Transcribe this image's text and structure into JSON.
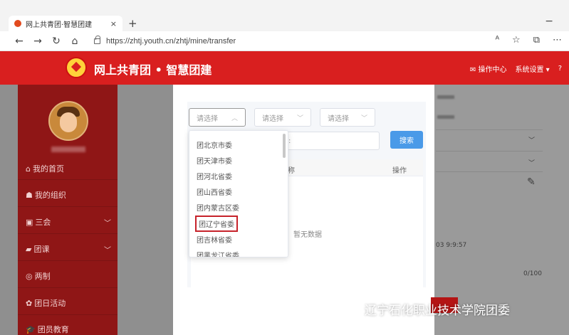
{
  "browser": {
    "tab_title": "网上共青团·智慧团建",
    "tab_close": "×",
    "new_tab": "+",
    "minimize": "−",
    "url": "https://zhtj.youth.cn/zhtj/mine/transfer",
    "nav_icons": [
      "back-arrow-icon",
      "forward-arrow-icon",
      "refresh-icon",
      "home-icon"
    ],
    "addr_icons": [
      "read-aloud-icon",
      "favorite-star-icon",
      "collections-icon",
      "more-icon"
    ]
  },
  "header": {
    "site_title": "网上共青团 • 智慧团建",
    "message_center": "操作中心",
    "system_settings": "系统设置",
    "brand_color": "#d91f1f"
  },
  "sidebar": {
    "items": [
      {
        "label": "我的首页",
        "icon": "home-icon"
      },
      {
        "label": "我的组织",
        "icon": "people-icon"
      },
      {
        "label": "三会",
        "icon": "meeting-icon",
        "has_chevron": true
      },
      {
        "label": "团课",
        "icon": "folder-icon",
        "has_chevron": true
      },
      {
        "label": "两制",
        "icon": "circle-icon"
      },
      {
        "label": "团日活动",
        "icon": "activity-icon"
      },
      {
        "label": "团员教育",
        "icon": "education-icon"
      }
    ]
  },
  "background_content": {
    "datetime_fragment": "03 9:9:57",
    "counter": "0/100"
  },
  "modal": {
    "select1": "请选择",
    "select2": "请选择",
    "select3": "请选择",
    "search_button": "搜索",
    "col_name": "称",
    "col_action": "操作",
    "empty_text": "暂无数据",
    "accent_color": "#4a9ae8"
  },
  "dropdown": {
    "options": [
      "团北京市委",
      "团天津市委",
      "团河北省委",
      "团山西省委",
      "团内蒙古区委",
      "团辽宁省委",
      "团吉林省委",
      "团黑龙江省委"
    ],
    "selected_index": 5
  },
  "watermark": {
    "text": "辽宁石化职业技术学院团委"
  }
}
